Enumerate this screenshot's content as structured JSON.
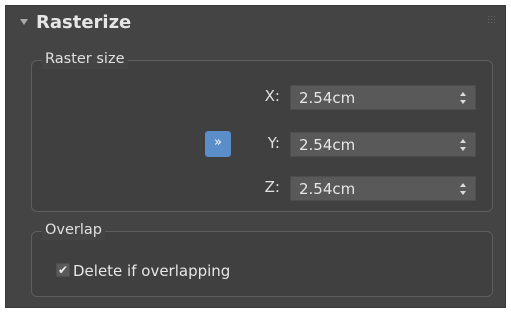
{
  "rollout": {
    "title": "Rasterize"
  },
  "raster_size": {
    "label": "Raster size",
    "lock_symbol": "»",
    "fields": [
      {
        "axis": "X:",
        "value": "2.54cm"
      },
      {
        "axis": "Y:",
        "value": "2.54cm"
      },
      {
        "axis": "Z:",
        "value": "2.54cm"
      }
    ]
  },
  "overlap": {
    "label": "Overlap",
    "delete_if_overlapping": {
      "label": "Delete if overlapping",
      "checked": true,
      "check_mark": "✔"
    }
  },
  "colors": {
    "panel_bg": "#444444",
    "field_bg": "#595959",
    "accent_button": "#5b8dc9",
    "text": "#e0e0e0"
  },
  "icons": {
    "collapse": "triangle-down-icon",
    "grip": "grip-dots-icon",
    "lock": "double-chevron-right-icon",
    "spinner": "spinner-arrows-icon",
    "checkbox": "checkmark-icon"
  }
}
